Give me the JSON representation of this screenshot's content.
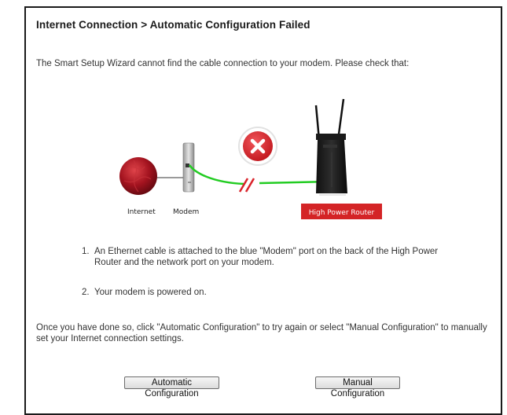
{
  "page": {
    "title": "Internet Connection > Automatic Configuration Failed",
    "intro": "The Smart Setup Wizard cannot find the cable connection to your modem. Please check that:"
  },
  "diagram": {
    "internet_label": "Internet",
    "modem_label": "Modem",
    "router_label": "High Power Router",
    "error_icon": "x-circle-icon",
    "colors": {
      "cable": "#22cc22",
      "error": "#d9232a",
      "router_label_bg": "#d42426",
      "globe": "#a3131f"
    }
  },
  "steps": [
    {
      "num": "1.",
      "text": "An Ethernet cable is attached to the blue \"Modem\" port on the back of the High Power Router and the network port on your modem."
    },
    {
      "num": "2.",
      "text": "Your modem is powered on."
    }
  ],
  "outro": "Once you have done so, click \"Automatic Configuration\" to try again or select \"Manual Configuration\" to manually set your Internet connection settings.",
  "buttons": {
    "automatic": "Automatic Configuration",
    "manual": "Manual Configuration"
  }
}
